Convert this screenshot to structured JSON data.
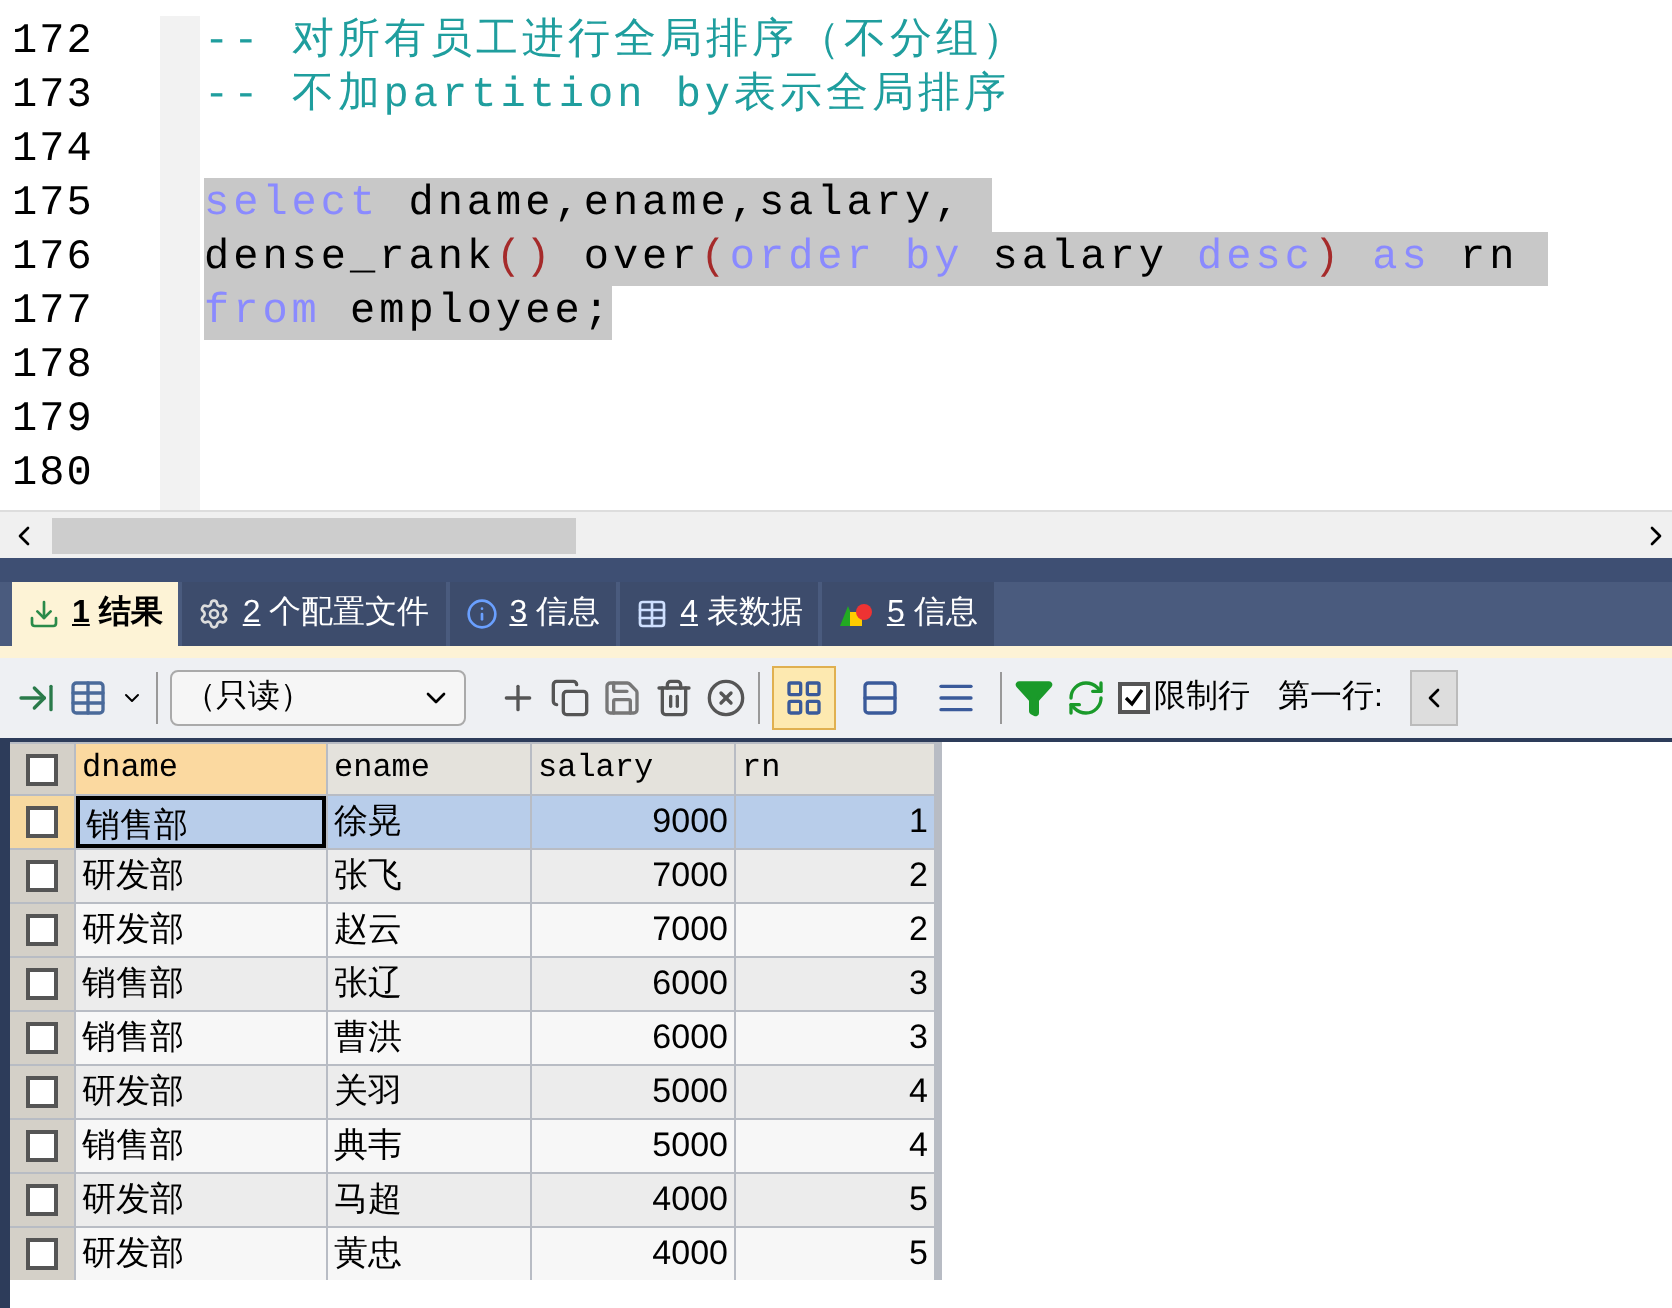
{
  "editor": {
    "lines": [
      {
        "number": "172",
        "selected": false,
        "tokens": [
          {
            "kind": "comment",
            "text": "-- 对所有员工进行全局排序（不分组）"
          }
        ]
      },
      {
        "number": "173",
        "selected": false,
        "tokens": [
          {
            "kind": "comment",
            "text": "-- 不加partition by表示全局排序"
          }
        ]
      },
      {
        "number": "174",
        "selected": false
      },
      {
        "number": "175",
        "selected": true,
        "tokens": [
          {
            "kind": "keyword",
            "text": "select"
          },
          {
            "kind": "plain",
            "text": " dname,ename,salary, "
          }
        ]
      },
      {
        "number": "176",
        "selected": true,
        "tokens": [
          {
            "kind": "plain",
            "text": "dense_rank"
          },
          {
            "kind": "paren",
            "text": "()"
          },
          {
            "kind": "plain",
            "text": " over"
          },
          {
            "kind": "paren",
            "text": "("
          },
          {
            "kind": "keyword",
            "text": "order by"
          },
          {
            "kind": "plain",
            "text": " salary "
          },
          {
            "kind": "keyword",
            "text": "desc"
          },
          {
            "kind": "paren",
            "text": ")"
          },
          {
            "kind": "keyword",
            "text": " as"
          },
          {
            "kind": "plain",
            "text": " rn "
          }
        ]
      },
      {
        "number": "177",
        "selected": true,
        "tokens": [
          {
            "kind": "keyword",
            "text": "from"
          },
          {
            "kind": "plain",
            "text": " employee;"
          }
        ]
      },
      {
        "number": "178",
        "selected": false
      },
      {
        "number": "179",
        "selected": false
      },
      {
        "number": "180",
        "selected": false
      }
    ]
  },
  "tabs": [
    {
      "kind": "result",
      "number": "1",
      "label": "结果",
      "selected": true
    },
    {
      "kind": "profile",
      "number": "2",
      "label": "个配置文件",
      "selected": false
    },
    {
      "kind": "info",
      "number": "3",
      "label": "信息",
      "selected": false
    },
    {
      "kind": "table",
      "number": "4",
      "label": "表数据",
      "selected": false
    },
    {
      "kind": "shapes",
      "number": "5",
      "label": "信息",
      "selected": false
    }
  ],
  "toolbar": {
    "mode": {
      "value": "（只读）"
    },
    "view_modes": [
      {
        "kind": "grid",
        "selected": true
      },
      {
        "kind": "form",
        "selected": false
      },
      {
        "kind": "text",
        "selected": false
      }
    ],
    "limit_rows": {
      "label": "限制行",
      "checked": true
    },
    "first_row": {
      "label": "第一行:"
    }
  },
  "grid": {
    "select_all": {
      "checked": false
    },
    "columns": [
      {
        "label": "dname",
        "selected": true
      },
      {
        "label": "ename",
        "selected": false
      },
      {
        "label": "salary",
        "selected": false
      },
      {
        "label": "rn",
        "selected": false
      }
    ],
    "rows": [
      {
        "selected": true,
        "checked": false,
        "cells": [
          "销售部",
          "徐晃",
          "9000",
          "1"
        ]
      },
      {
        "selected": false,
        "checked": false,
        "cells": [
          "研发部",
          "张飞",
          "7000",
          "2"
        ]
      },
      {
        "selected": false,
        "checked": false,
        "cells": [
          "研发部",
          "赵云",
          "7000",
          "2"
        ]
      },
      {
        "selected": false,
        "checked": false,
        "cells": [
          "销售部",
          "张辽",
          "6000",
          "3"
        ]
      },
      {
        "selected": false,
        "checked": false,
        "cells": [
          "销售部",
          "曹洪",
          "6000",
          "3"
        ]
      },
      {
        "selected": false,
        "checked": false,
        "cells": [
          "研发部",
          "关羽",
          "5000",
          "4"
        ]
      },
      {
        "selected": false,
        "checked": false,
        "cells": [
          "销售部",
          "典韦",
          "5000",
          "4"
        ]
      },
      {
        "selected": false,
        "checked": false,
        "cells": [
          "研发部",
          "马超",
          "4000",
          "5"
        ]
      },
      {
        "selected": false,
        "checked": false,
        "cells": [
          "研发部",
          "黄忠",
          "4000",
          "5"
        ]
      }
    ]
  }
}
